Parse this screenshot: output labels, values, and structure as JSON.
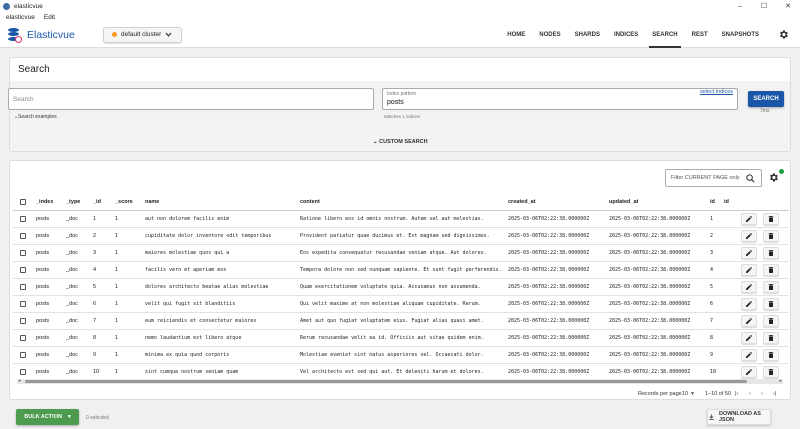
{
  "window": {
    "title": "elasticvue",
    "controls": [
      "–",
      "☐",
      "✕"
    ]
  },
  "menubar": {
    "items": [
      "elasticvue",
      "Edit"
    ]
  },
  "header": {
    "brand": "Elasticvue",
    "cluster": "default cluster",
    "nav": [
      "HOME",
      "NODES",
      "SHARDS",
      "INDICES",
      "SEARCH",
      "REST",
      "SNAPSHOTS"
    ],
    "active_tab": "SEARCH"
  },
  "search": {
    "title": "Search",
    "query_placeholder": "Search",
    "index_label": "Index pattern",
    "index_value": "posts",
    "select_indices": "select indices",
    "button": "SEARCH",
    "took": "7ms",
    "examples": "Search examples",
    "hint": "Matches 1 indices",
    "custom_search": "CUSTOM SEARCH"
  },
  "results": {
    "filter_placeholder": "Filter CURRENT PAGE only",
    "columns": [
      "_index",
      "_type",
      "_id",
      "_score",
      "name",
      "content",
      "created_at",
      "updated_at",
      "id",
      "id"
    ],
    "rows": [
      [
        "posts",
        "_doc",
        "1",
        "1",
        "aut non dolorem facilis enim",
        "Ratione libero eos id omnis nostrum. Autem vel aut molestias.",
        "2025-03-06T02:22:38.000000Z",
        "2025-03-06T02:22:38.000000Z",
        "1"
      ],
      [
        "posts",
        "_doc",
        "2",
        "1",
        "cupiditate dolor inventore odit temporibus",
        "Provident pariatur quae ducimus et. Est magnam sed dignissimos.",
        "2025-03-06T02:22:38.000000Z",
        "2025-03-06T02:22:38.000000Z",
        "2"
      ],
      [
        "posts",
        "_doc",
        "3",
        "1",
        "maiores molestiae quos qui a",
        "Eos expedita consequatur recusandae veniam atque. Aut dolores.",
        "2025-03-06T02:22:38.000000Z",
        "2025-03-06T02:22:38.000000Z",
        "3"
      ],
      [
        "posts",
        "_doc",
        "4",
        "1",
        "facilis vero et aperiam eos",
        "Tempora dolore non sed nunquam sapiente. Et sunt fugit perferendis.",
        "2025-03-06T02:22:38.000000Z",
        "2025-03-06T02:22:38.000000Z",
        "4"
      ],
      [
        "posts",
        "_doc",
        "5",
        "1",
        "dolores architecto beatae alias molestiae",
        "Quam exercitationem voluptate quia. Accusamus non assumenda.",
        "2025-03-06T02:22:38.000000Z",
        "2025-03-06T02:22:38.000000Z",
        "5"
      ],
      [
        "posts",
        "_doc",
        "6",
        "1",
        "velit qui fugit sit blanditiis",
        "Qui velit maxime at non molestiae aliquam cupiditate. Rerum.",
        "2025-03-06T02:22:38.000000Z",
        "2025-03-06T02:22:38.000000Z",
        "6"
      ],
      [
        "posts",
        "_doc",
        "7",
        "1",
        "eum reiciendis et consectetur maiores",
        "Amet aut quo fugiat voluptatem eius. Fugiat alias quasi amet.",
        "2025-03-06T02:22:38.000000Z",
        "2025-03-06T02:22:38.000000Z",
        "7"
      ],
      [
        "posts",
        "_doc",
        "8",
        "1",
        "nemo laudantium est libero atque",
        "Rerum recusandae velit ea id. Officiis aut vitae quidem enim.",
        "2025-03-06T02:22:38.000000Z",
        "2025-03-06T02:22:38.000000Z",
        "8"
      ],
      [
        "posts",
        "_doc",
        "9",
        "1",
        "minima ex quia quod corporis",
        "Molestiae eveniet sint natus asperiores vel. Occaecati dolor.",
        "2025-03-06T02:22:38.000000Z",
        "2025-03-06T02:22:38.000000Z",
        "9"
      ],
      [
        "posts",
        "_doc",
        "10",
        "1",
        "sint cumque nostrum veniam quam",
        "Vel architecto est sed qui aut. Et deleniti harum et dolores.",
        "2025-03-06T02:22:38.000000Z",
        "2025-03-06T02:22:38.000000Z",
        "10"
      ]
    ]
  },
  "pagination": {
    "label": "Records per page",
    "per_page": "10",
    "range": "1–10 of 50",
    "first": "|‹",
    "prev": "‹",
    "next": "›",
    "last": "›|"
  },
  "footer": {
    "bulk_action": "BULK ACTION",
    "selected": "0 selected",
    "download": "DOWNLOAD AS JSON"
  },
  "colors": {
    "accent": "#1a57a8",
    "bulk": "#4d9b4e",
    "cluster_dot": "#f29a1e",
    "status_dot": "#1e9b3b"
  }
}
